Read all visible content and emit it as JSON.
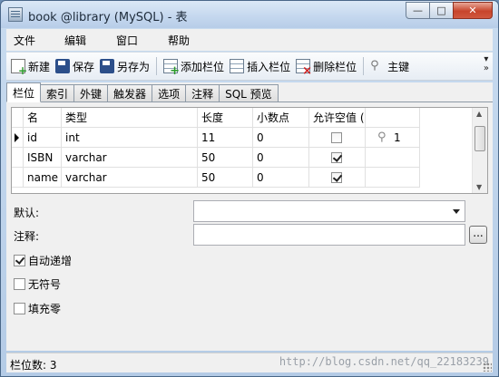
{
  "window": {
    "title": "book @library (MySQL) - 表"
  },
  "menu": [
    "文件",
    "编辑",
    "窗口",
    "帮助"
  ],
  "toolbar": {
    "new": "新建",
    "save": "保存",
    "save_as": "另存为",
    "add_field": "添加栏位",
    "insert_field": "插入栏位",
    "delete_field": "删除栏位",
    "primary_key": "主键"
  },
  "tabs": [
    "栏位",
    "索引",
    "外键",
    "触发器",
    "选项",
    "注释",
    "SQL 预览"
  ],
  "grid": {
    "columns": [
      "名",
      "类型",
      "长度",
      "小数点",
      "允许空值 ("
    ],
    "rows": [
      {
        "name": "id",
        "type": "int",
        "length": "11",
        "decimals": "0",
        "allow_null": false,
        "key": "1",
        "current": true
      },
      {
        "name": "ISBN",
        "type": "varchar",
        "length": "50",
        "decimals": "0",
        "allow_null": true,
        "key": "",
        "current": false
      },
      {
        "name": "name",
        "type": "varchar",
        "length": "50",
        "decimals": "0",
        "allow_null": true,
        "key": "",
        "current": false
      }
    ]
  },
  "props": {
    "default_label": "默认:",
    "default_value": "",
    "comment_label": "注释:",
    "comment_value": "",
    "ellipsis": "...",
    "auto_increment": {
      "label": "自动递增",
      "checked": true
    },
    "unsigned": {
      "label": "无符号",
      "checked": false
    },
    "zerofill": {
      "label": "填充零",
      "checked": false
    }
  },
  "status": {
    "field_count": "栏位数: 3",
    "watermark": "http://blog.csdn.net/qq_22183239"
  }
}
